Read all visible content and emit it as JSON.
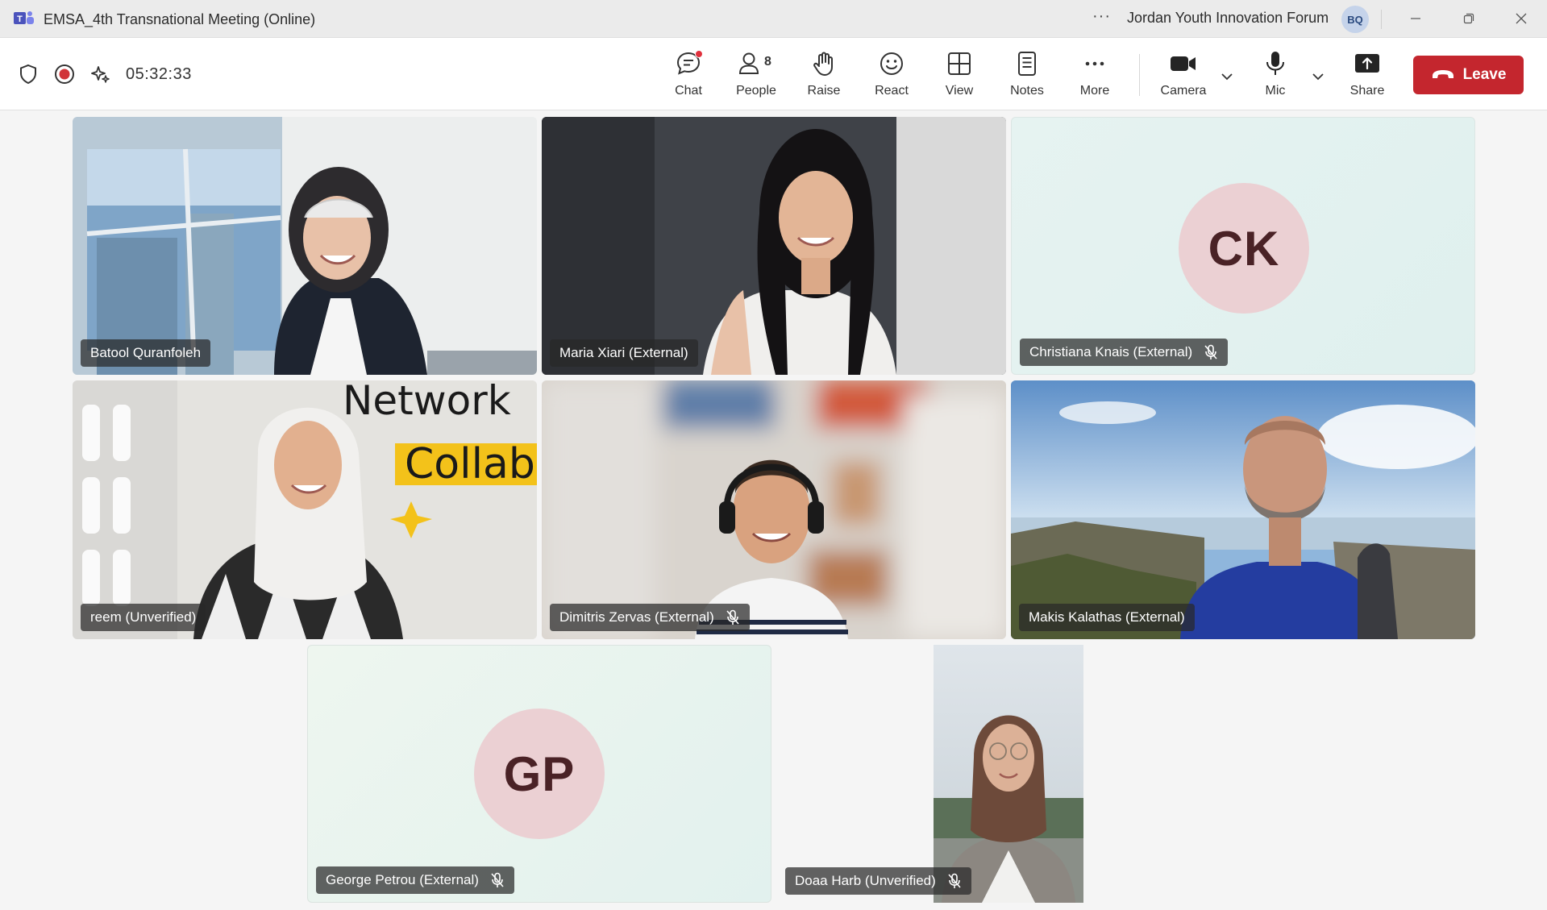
{
  "window": {
    "title": "EMSA_4th Transnational Meeting (Online)",
    "more_glyph": "···",
    "org_name": "Jordan Youth Innovation Forum",
    "org_initials": "BQ"
  },
  "toolbar": {
    "timer": "05:32:33",
    "people_count": "8",
    "buttons": {
      "chat": "Chat",
      "people": "People",
      "raise": "Raise",
      "react": "React",
      "view": "View",
      "notes": "Notes",
      "more": "More",
      "camera": "Camera",
      "mic": "Mic",
      "share": "Share"
    },
    "leave": "Leave"
  },
  "participants": [
    {
      "name": "Batool Quranfoleh",
      "muted": false
    },
    {
      "name": "Maria Xiari (External)",
      "muted": false
    },
    {
      "name": "Christiana Knais (External)",
      "initials": "CK",
      "muted": true
    },
    {
      "name": "reem (Unverified)",
      "muted": false
    },
    {
      "name": "Dimitris Zervas (External)",
      "muted": true
    },
    {
      "name": "Makis Kalathas (External)",
      "muted": false
    },
    {
      "name": "George Petrou (External)",
      "initials": "GP",
      "muted": true
    },
    {
      "name": "Doaa Harb (Unverified)",
      "muted": true
    }
  ],
  "sign_text": {
    "line1": "Network",
    "line2": "Collab"
  },
  "colors": {
    "leave": "#c4262e",
    "avatar_bg": "#ebd0d3",
    "recording": "#d13438",
    "teams_brand": "#4b53bc"
  }
}
